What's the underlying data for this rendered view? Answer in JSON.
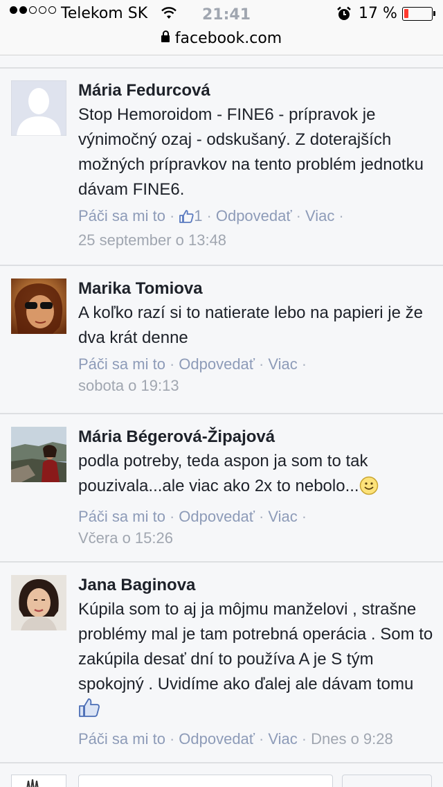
{
  "status_bar": {
    "carrier": "Telekom SK",
    "time": "21:41",
    "battery_percent": "17 %",
    "battery_level": 0.17
  },
  "url_bar": {
    "url": "facebook.com"
  },
  "comments": [
    {
      "author": "Mária Fedurcová",
      "text": "Stop Hemoroidom - FINE6 - prípravok je výnimočný ozaj - odskušaný. Z doterajších možných prípravkov na tento problém jednotku dávam FINE6.",
      "like_label": "Páči sa mi to",
      "like_count": "1",
      "reply_label": "Odpovedať",
      "more_label": "Viac",
      "timestamp": "25 september o 13:48"
    },
    {
      "author": "Marika Tomiova",
      "text": "A koľko razí si to natierate lebo na papieri je že dva krát denne",
      "like_label": "Páči sa mi to",
      "reply_label": "Odpovedať",
      "more_label": "Viac",
      "timestamp": "sobota o 19:13"
    },
    {
      "author": "Mária Bégerová-Žipajová",
      "text": "podla potreby, teda aspon ja som to tak pouzivala...ale viac ako 2x to nebolo...",
      "like_label": "Páči sa mi to",
      "reply_label": "Odpovedať",
      "more_label": "Viac",
      "timestamp": "Včera o 15:26"
    },
    {
      "author": "Jana Baginova",
      "text": "Kúpila som to aj ja môjmu manželovi , strašne problémy mal je tam potrebná operácia . Som to zakúpila desať dní to používa A je S tým spokojný . Uvidíme ako ďalej ale dávam tomu",
      "like_label": "Páči sa mi to",
      "reply_label": "Odpovedať",
      "more_label": "Viac",
      "timestamp": "Dnes o 9:28"
    }
  ]
}
